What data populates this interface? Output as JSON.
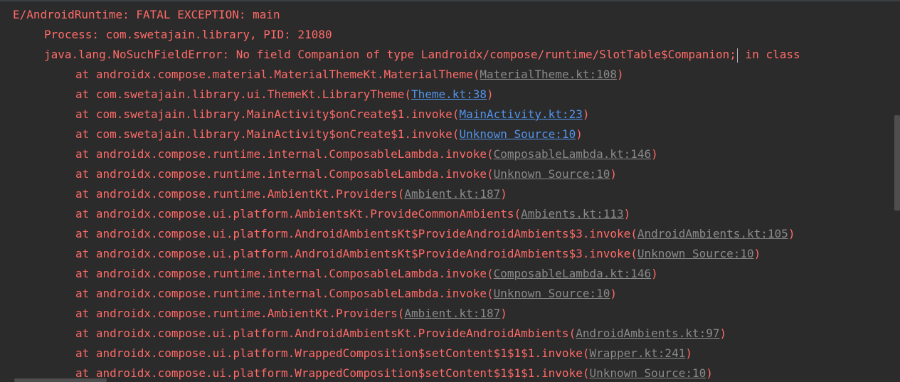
{
  "colors": {
    "background": "#2b2b2b",
    "error_text": "#ff6b68",
    "link_muted": "#8a8a8a",
    "link_active": "#5394ec"
  },
  "log": {
    "header": "E/AndroidRuntime: FATAL EXCEPTION: main",
    "process": "Process: com.swetajain.library, PID: 21080",
    "exception_before_caret": "java.lang.NoSuchFieldError: No field Companion of type Landroidx/compose/runtime/SlotTable$Companion;",
    "exception_after_caret": " in class",
    "frames": [
      {
        "text": "at androidx.compose.material.MaterialThemeKt.MaterialTheme(",
        "link": "MaterialTheme.kt:108",
        "active": false
      },
      {
        "text": "at com.swetajain.library.ui.ThemeKt.LibraryTheme(",
        "link": "Theme.kt:38",
        "active": true
      },
      {
        "text": "at com.swetajain.library.MainActivity$onCreate$1.invoke(",
        "link": "MainActivity.kt:23",
        "active": true
      },
      {
        "text": "at com.swetajain.library.MainActivity$onCreate$1.invoke(",
        "link": "Unknown Source:10",
        "active": true
      },
      {
        "text": "at androidx.compose.runtime.internal.ComposableLambda.invoke(",
        "link": "ComposableLambda.kt:146",
        "active": false
      },
      {
        "text": "at androidx.compose.runtime.internal.ComposableLambda.invoke(",
        "link": "Unknown Source:10",
        "active": false
      },
      {
        "text": "at androidx.compose.runtime.AmbientKt.Providers(",
        "link": "Ambient.kt:187",
        "active": false
      },
      {
        "text": "at androidx.compose.ui.platform.AmbientsKt.ProvideCommonAmbients(",
        "link": "Ambients.kt:113",
        "active": false
      },
      {
        "text": "at androidx.compose.ui.platform.AndroidAmbientsKt$ProvideAndroidAmbients$3.invoke(",
        "link": "AndroidAmbients.kt:105",
        "active": false
      },
      {
        "text": "at androidx.compose.ui.platform.AndroidAmbientsKt$ProvideAndroidAmbients$3.invoke(",
        "link": "Unknown Source:10",
        "active": false
      },
      {
        "text": "at androidx.compose.runtime.internal.ComposableLambda.invoke(",
        "link": "ComposableLambda.kt:146",
        "active": false
      },
      {
        "text": "at androidx.compose.runtime.internal.ComposableLambda.invoke(",
        "link": "Unknown Source:10",
        "active": false
      },
      {
        "text": "at androidx.compose.runtime.AmbientKt.Providers(",
        "link": "Ambient.kt:187",
        "active": false
      },
      {
        "text": "at androidx.compose.ui.platform.AndroidAmbientsKt.ProvideAndroidAmbients(",
        "link": "AndroidAmbients.kt:97",
        "active": false
      },
      {
        "text": "at androidx.compose.ui.platform.WrappedComposition$setContent$1$1$1.invoke(",
        "link": "Wrapper.kt:241",
        "active": false
      },
      {
        "text": "at androidx.compose.ui.platform.WrappedComposition$setContent$1$1$1.invoke(",
        "link": "Unknown Source:10",
        "active": false
      }
    ],
    "close_paren": ")"
  }
}
